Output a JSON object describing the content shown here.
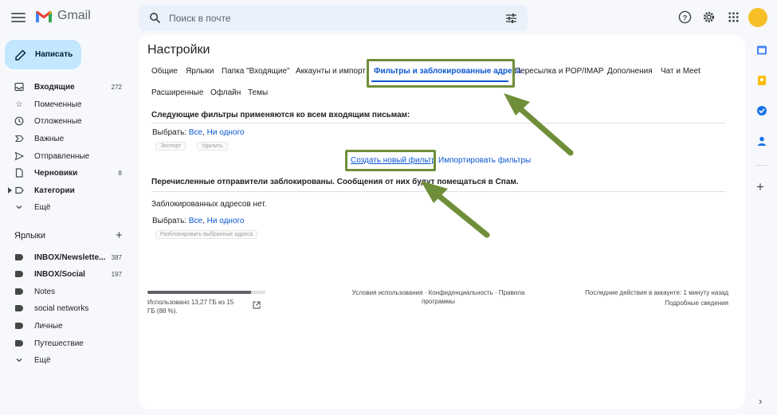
{
  "app": {
    "name": "Gmail"
  },
  "search": {
    "placeholder": "Поиск в почте"
  },
  "compose": {
    "label": "Написать"
  },
  "sidebar": {
    "items": [
      {
        "label": "Входящие",
        "count": "272",
        "bold": true,
        "icon": "inbox-icon"
      },
      {
        "label": "Помеченные",
        "count": "",
        "bold": false,
        "icon": "star-icon"
      },
      {
        "label": "Отложенные",
        "count": "",
        "bold": false,
        "icon": "clock-icon"
      },
      {
        "label": "Важные",
        "count": "",
        "bold": false,
        "icon": "important-icon"
      },
      {
        "label": "Отправленные",
        "count": "",
        "bold": false,
        "icon": "send-icon"
      },
      {
        "label": "Черновики",
        "count": "8",
        "bold": true,
        "icon": "draft-icon"
      },
      {
        "label": "Категории",
        "count": "",
        "bold": true,
        "icon": "category-icon"
      },
      {
        "label": "Ещё",
        "count": "",
        "bold": false,
        "icon": "chevron-down-icon"
      }
    ],
    "labels_title": "Ярлыки",
    "labels": [
      {
        "label": "INBOX/Newslette...",
        "count": "387",
        "bold": true
      },
      {
        "label": "INBOX/Social",
        "count": "197",
        "bold": true
      },
      {
        "label": "Notes",
        "count": "",
        "bold": false
      },
      {
        "label": "social networks",
        "count": "",
        "bold": false
      },
      {
        "label": "Личные",
        "count": "",
        "bold": false
      },
      {
        "label": "Путешествие",
        "count": "",
        "bold": false
      }
    ],
    "labels_more": "Ещё"
  },
  "settings": {
    "title": "Настройки",
    "tabs": [
      "Общие",
      "Ярлыки",
      "Папка \"Входящие\"",
      "Аккаунты и импорт",
      "Фильтры и заблокированные адреса",
      "Пересылка и POP/IMAP",
      "Дополнения",
      "Чат и Meet",
      "Расширенные",
      "Офлайн",
      "Темы"
    ],
    "active_tab": "Фильтры и заблокированные адреса",
    "filters": {
      "heading": "Следующие фильтры применяются ко всем входящим письмам:",
      "select_label": "Выбрать:",
      "select_all": "Все",
      "select_none": "Ни одного",
      "export_btn": "Экспорт",
      "delete_btn": "Удалить",
      "create_filter": "Создать новый фильтр",
      "import_filters": "Импортировать фильтры"
    },
    "blocked": {
      "heading": "Перечисленные отправители заблокированы. Сообщения от них будут помещаться в Спам.",
      "empty_text": "Заблокированных адресов нет.",
      "select_label": "Выбрать:",
      "select_all": "Все",
      "select_none": "Ни одного",
      "unblock_btn": "Разблокировать выбранные адреса"
    }
  },
  "footer": {
    "storage_text": "Использовано 13,27 ГБ из 15 ГБ (88 %).",
    "storage_fraction": 0.88,
    "terms": "Условия использования · Конфиденциальность · Правила программы",
    "last_activity": "Последние действия в аккаунте: 1 минуту назад",
    "details": "Подробные сведения"
  },
  "colors": {
    "accent": "#0b57d0",
    "compose_bg": "#c2e7ff",
    "highlight": "#6f8e3a",
    "avatar": "#f6bf26"
  }
}
